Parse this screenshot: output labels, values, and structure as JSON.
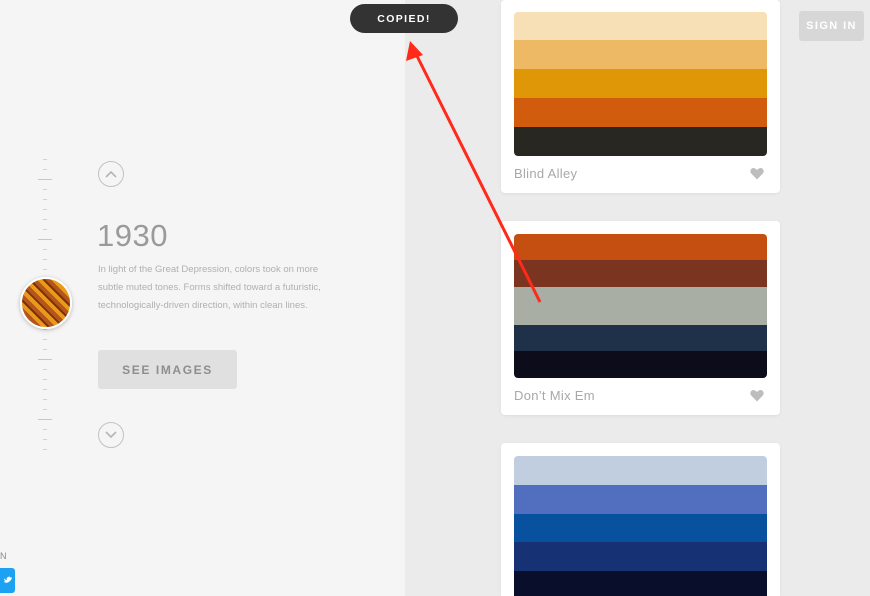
{
  "timeline": {
    "year": "1930",
    "description": "In light of the Great Depression, colors took on more subtle muted tones. Forms shifted toward a futuristic, technologically-driven direction, within clean lines.",
    "see_images_label": "SEE IMAGES"
  },
  "toast": {
    "label": "COPIED!"
  },
  "header": {
    "sign_in_label": "SIGN IN"
  },
  "footer": {
    "partial_letter": "N"
  },
  "palettes": [
    {
      "name": "Blind Alley",
      "colors": [
        "#f8e0b6",
        "#edb965",
        "#df9707",
        "#d15c0d",
        "#282722"
      ]
    },
    {
      "name": "Don’t Mix Em",
      "colors": [
        "#c44f10",
        "#7b3420",
        "#a8aea3",
        "#1e3149",
        "#0d0c1a"
      ]
    },
    {
      "name": "",
      "colors": [
        "#c1cee0",
        "#526ebf",
        "#08519f",
        "#163274",
        "#090f2a"
      ]
    }
  ],
  "icons": {
    "up": "chevron-up-icon",
    "down": "chevron-down-icon",
    "heart": "heart-icon",
    "twitter": "twitter-icon"
  }
}
